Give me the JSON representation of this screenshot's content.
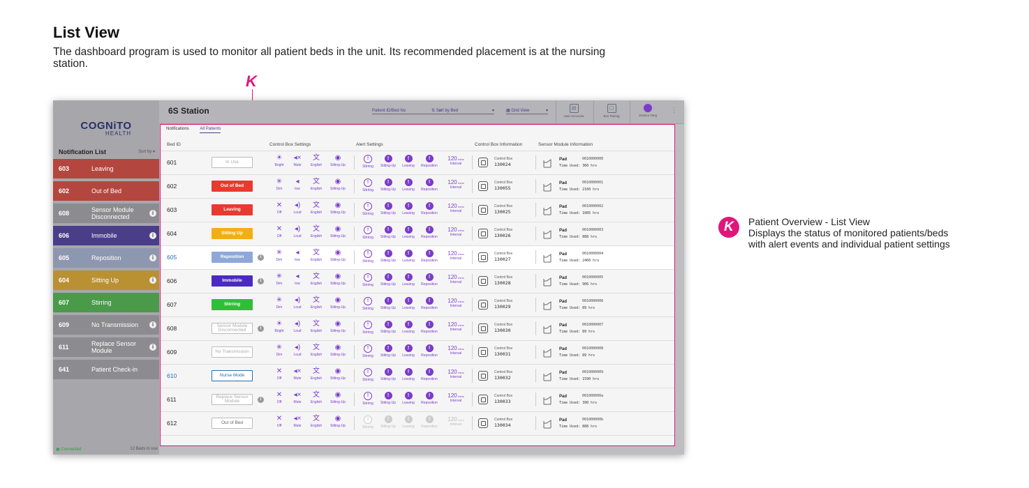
{
  "doc": {
    "title": "List View",
    "description": "The dashboard program is used to monitor all patient beds in the unit. Its recommended placement is at the nursing station.",
    "marker": "K"
  },
  "annotation": {
    "marker": "K",
    "title": "Patient Overview - List View",
    "line1": "Displays the status of monitored patients/beds",
    "line2": "with alert events and individual patient settings"
  },
  "app": {
    "logo": {
      "main": "COGNiTO",
      "sub": "HEALTH"
    },
    "station": "6S Station",
    "search_placeholder": "Patient ID/Bed No",
    "sort_label": "Sort by Bed",
    "view_label": "Grid View",
    "toolbar": {
      "user_accounts": "User Accounts",
      "box_pairing": "Box Pairing",
      "user_name": "Jessica Tang"
    },
    "sidebar": {
      "heading": "Notification List",
      "sort": "Sort by",
      "footer_status": "Connected",
      "footer_beds": "12 Beds in use",
      "items": [
        {
          "bed": "603",
          "label": "Leaving",
          "color": "#b3473f",
          "info": false
        },
        {
          "bed": "602",
          "label": "Out of Bed",
          "color": "#b3473f",
          "info": false
        },
        {
          "bed": "608",
          "label": "Sensor Module Disconnected",
          "color": "#8c8c90",
          "info": true
        },
        {
          "bed": "606",
          "label": "Immobile",
          "color": "#4a3d8a",
          "info": true
        },
        {
          "bed": "605",
          "label": "Reposition",
          "color": "#8e97b0",
          "info": true
        },
        {
          "bed": "604",
          "label": "Sitting Up",
          "color": "#b99133",
          "info": true
        },
        {
          "bed": "607",
          "label": "Stirring",
          "color": "#4a9a4a",
          "info": false
        },
        {
          "bed": "609",
          "label": "No Transmission",
          "color": "#8c8c90",
          "info": true
        },
        {
          "bed": "611",
          "label": "Replace Sensor Module",
          "color": "#8c8c90",
          "info": true
        },
        {
          "bed": "641",
          "label": "Patient Check-in",
          "color": "#8c8c90",
          "info": false
        }
      ]
    },
    "tabs": [
      "Notifications",
      "All Patients"
    ],
    "headers": {
      "bed_id": "Bed ID",
      "control_box_settings": "Control Box Settings",
      "alert_settings": "Alert Settings",
      "control_box_info": "Control Box Information",
      "sensor_module_info": "Sensor Module Information"
    },
    "alert_labels": [
      "Stirring",
      "Sitting-Up",
      "Leaving",
      "Reposition"
    ],
    "interval_value": "120",
    "interval_unit": "mins",
    "interval_label": "Interval",
    "control_box_label": "Control Box",
    "pad_label": "Pad",
    "time_used_label": "Time Used:",
    "icons": {
      "bright": "sun-icon",
      "dim": "dim-sun-icon",
      "off": "x-icon",
      "mute": "speaker-mute-icon",
      "low": "speaker-low-icon",
      "loud": "speaker-loud-icon",
      "english": "translate-icon",
      "sitting_up": "sitting-up-icon",
      "control_box": "control-box-icon",
      "sensor": "bed-sensor-icon",
      "info": "info-icon"
    },
    "colors": {
      "accent": "#7b3cc9",
      "highlight": "#e0177b",
      "link_blue": "#1f6fb3"
    },
    "rows": [
      {
        "bed": "601",
        "status": "In Use",
        "style": "st-inuse",
        "info": false,
        "light": "Bright",
        "light_g": "☀",
        "sound": "Mute",
        "sound_g": "◂×",
        "lang": "English",
        "sit": "Sitting-Up",
        "alerts_enabled": true,
        "cbox": "130024",
        "code": "0010000000",
        "time": "360 hrs",
        "sel": false,
        "blue": false
      },
      {
        "bed": "602",
        "status": "Out of Bed",
        "style": "st-red",
        "info": false,
        "light": "Dim",
        "light_g": "✳",
        "sound": "low",
        "sound_g": "◂",
        "lang": "English",
        "sit": "Sitting-Up",
        "alerts_enabled": true,
        "cbox": "130055",
        "code": "0010000001",
        "time": "2160 hrs",
        "sel": false,
        "blue": false
      },
      {
        "bed": "603",
        "status": "Leaving",
        "style": "st-red",
        "info": false,
        "light": "Off",
        "light_g": "✕",
        "sound": "Loud",
        "sound_g": "◂)",
        "lang": "English",
        "sit": "Sitting-Up",
        "alerts_enabled": true,
        "cbox": "130025",
        "code": "0010000002",
        "time": "1085 hrs",
        "sel": false,
        "blue": false
      },
      {
        "bed": "604",
        "status": "Sitting Up",
        "style": "st-yellow",
        "info": false,
        "light": "Off",
        "light_g": "✕",
        "sound": "Loud",
        "sound_g": "◂)",
        "lang": "English",
        "sit": "Sitting-Up",
        "alerts_enabled": true,
        "cbox": "130026",
        "code": "0010000003",
        "time": "888 hrs",
        "sel": false,
        "blue": false
      },
      {
        "bed": "605",
        "status": "Reposition",
        "style": "st-lblue",
        "info": true,
        "light": "Dim",
        "light_g": "✳",
        "sound": "low",
        "sound_g": "◂",
        "lang": "English",
        "sit": "Sitting-Up",
        "alerts_enabled": true,
        "cbox": "130027",
        "code": "0010000004",
        "time": "2460 hrs",
        "sel": true,
        "blue": false
      },
      {
        "bed": "606",
        "status": "Immobile",
        "style": "st-purple",
        "info": true,
        "light": "Dim",
        "light_g": "✳",
        "sound": "low",
        "sound_g": "◂",
        "lang": "English",
        "sit": "Sitting-Up",
        "alerts_enabled": true,
        "cbox": "130028",
        "code": "0010000005",
        "time": "906 hrs",
        "sel": false,
        "blue": false
      },
      {
        "bed": "607",
        "status": "Stirring",
        "style": "st-green",
        "info": false,
        "light": "Dim",
        "light_g": "✳",
        "sound": "Loud",
        "sound_g": "◂)",
        "lang": "English",
        "sit": "Sitting-Up",
        "alerts_enabled": true,
        "cbox": "130029",
        "code": "0010000006",
        "time": "89 hrs",
        "sel": false,
        "blue": false
      },
      {
        "bed": "608",
        "status": "Sensor Module Disconnected",
        "style": "st-gray",
        "info": true,
        "light": "Bright",
        "light_g": "☀",
        "sound": "Loud",
        "sound_g": "◂)",
        "lang": "English",
        "sit": "Sitting-Up",
        "alerts_enabled": true,
        "cbox": "130030",
        "code": "0010000007",
        "time": "89 hrs",
        "sel": false,
        "blue": false
      },
      {
        "bed": "609",
        "status": "No Transmission",
        "style": "st-gray",
        "info": false,
        "light": "Dim",
        "light_g": "✳",
        "sound": "Loud",
        "sound_g": "◂)",
        "lang": "English",
        "sit": "Sitting-Up",
        "alerts_enabled": true,
        "cbox": "130031",
        "code": "0010000008",
        "time": "89 hrs",
        "sel": false,
        "blue": false
      },
      {
        "bed": "610",
        "status": "Nurse Mode",
        "style": "st-nurse",
        "info": false,
        "light": "Off",
        "light_g": "✕",
        "sound": "Mute",
        "sound_g": "◂×",
        "lang": "English",
        "sit": "Sitting-Up",
        "alerts_enabled": true,
        "cbox": "130032",
        "code": "0010000009",
        "time": "1590 hrs",
        "sel": false,
        "blue": true
      },
      {
        "bed": "611",
        "status": "Replace Sensor Module",
        "style": "st-gray",
        "info": true,
        "light": "Off",
        "light_g": "✕",
        "sound": "Mute",
        "sound_g": "◂×",
        "lang": "English",
        "sit": "Sitting-Up",
        "alerts_enabled": true,
        "cbox": "130033",
        "code": "001000000a",
        "time": "390 hrs",
        "sel": false,
        "blue": false
      },
      {
        "bed": "612",
        "status": "Out of Bed",
        "style": "st-outbed",
        "info": false,
        "light": "Off",
        "light_g": "✕",
        "sound": "Mute",
        "sound_g": "◂×",
        "lang": "English",
        "sit": "Sitting-Up",
        "alerts_enabled": false,
        "cbox": "130034",
        "code": "001000000b",
        "time": "888 hrs",
        "sel": false,
        "blue": false
      }
    ]
  }
}
